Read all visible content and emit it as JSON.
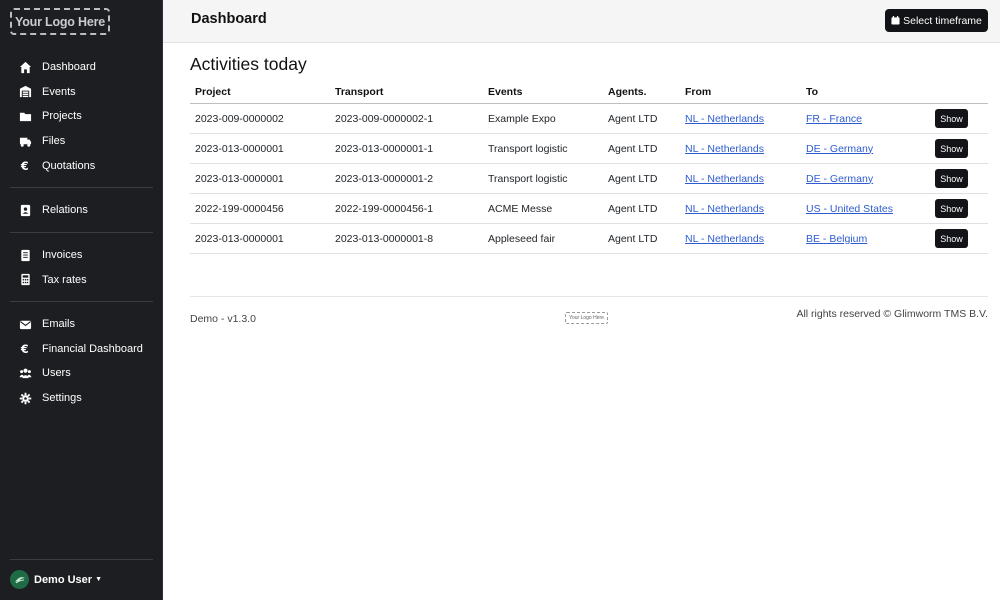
{
  "sidebar": {
    "logo_text": "Your Logo Here",
    "groups": [
      [
        {
          "label": "Dashboard",
          "icon": "home-icon"
        },
        {
          "label": "Events",
          "icon": "warehouse-icon"
        },
        {
          "label": "Projects",
          "icon": "folder-icon"
        },
        {
          "label": "Files",
          "icon": "truck-icon"
        },
        {
          "label": "Quotations",
          "icon": "euro-icon"
        }
      ],
      [
        {
          "label": "Relations",
          "icon": "address-book-icon"
        }
      ],
      [
        {
          "label": "Invoices",
          "icon": "invoice-icon"
        },
        {
          "label": "Tax rates",
          "icon": "calculator-icon"
        }
      ],
      [
        {
          "label": "Emails",
          "icon": "envelope-icon"
        },
        {
          "label": "Financial Dashboard",
          "icon": "euro-icon"
        },
        {
          "label": "Users",
          "icon": "users-icon"
        },
        {
          "label": "Settings",
          "icon": "gear-icon"
        }
      ]
    ],
    "user_name": "Demo User"
  },
  "header": {
    "title": "Dashboard",
    "timeframe_button": "Select timeframe"
  },
  "main": {
    "section_title": "Activities today",
    "columns": [
      "Project",
      "Transport",
      "Events",
      "Agents.",
      "From",
      "To",
      ""
    ],
    "rows": [
      {
        "project": "2023-009-0000002",
        "transport": "2023-009-0000002-1",
        "event": "Example Expo",
        "agent": "Agent LTD",
        "from": "NL - Netherlands",
        "to": "FR - France",
        "action": "Show"
      },
      {
        "project": "2023-013-0000001",
        "transport": "2023-013-0000001-1",
        "event": "Transport logistic",
        "agent": "Agent LTD",
        "from": "NL - Netherlands",
        "to": "DE - Germany",
        "action": "Show"
      },
      {
        "project": "2023-013-0000001",
        "transport": "2023-013-0000001-2",
        "event": "Transport logistic",
        "agent": "Agent LTD",
        "from": "NL - Netherlands",
        "to": "DE - Germany",
        "action": "Show"
      },
      {
        "project": "2022-199-0000456",
        "transport": "2022-199-0000456-1",
        "event": "ACME Messe",
        "agent": "Agent LTD",
        "from": "NL - Netherlands",
        "to": "US - United States",
        "action": "Show"
      },
      {
        "project": "2023-013-0000001",
        "transport": "2023-013-0000001-8",
        "event": "Appleseed fair",
        "agent": "Agent LTD",
        "from": "NL - Netherlands",
        "to": "BE - Belgium",
        "action": "Show"
      }
    ]
  },
  "footer": {
    "version": "Demo - v1.3.0",
    "logo_text": "Your Logo Here",
    "copyright": "All rights reserved © Glimworm TMS B.V."
  }
}
